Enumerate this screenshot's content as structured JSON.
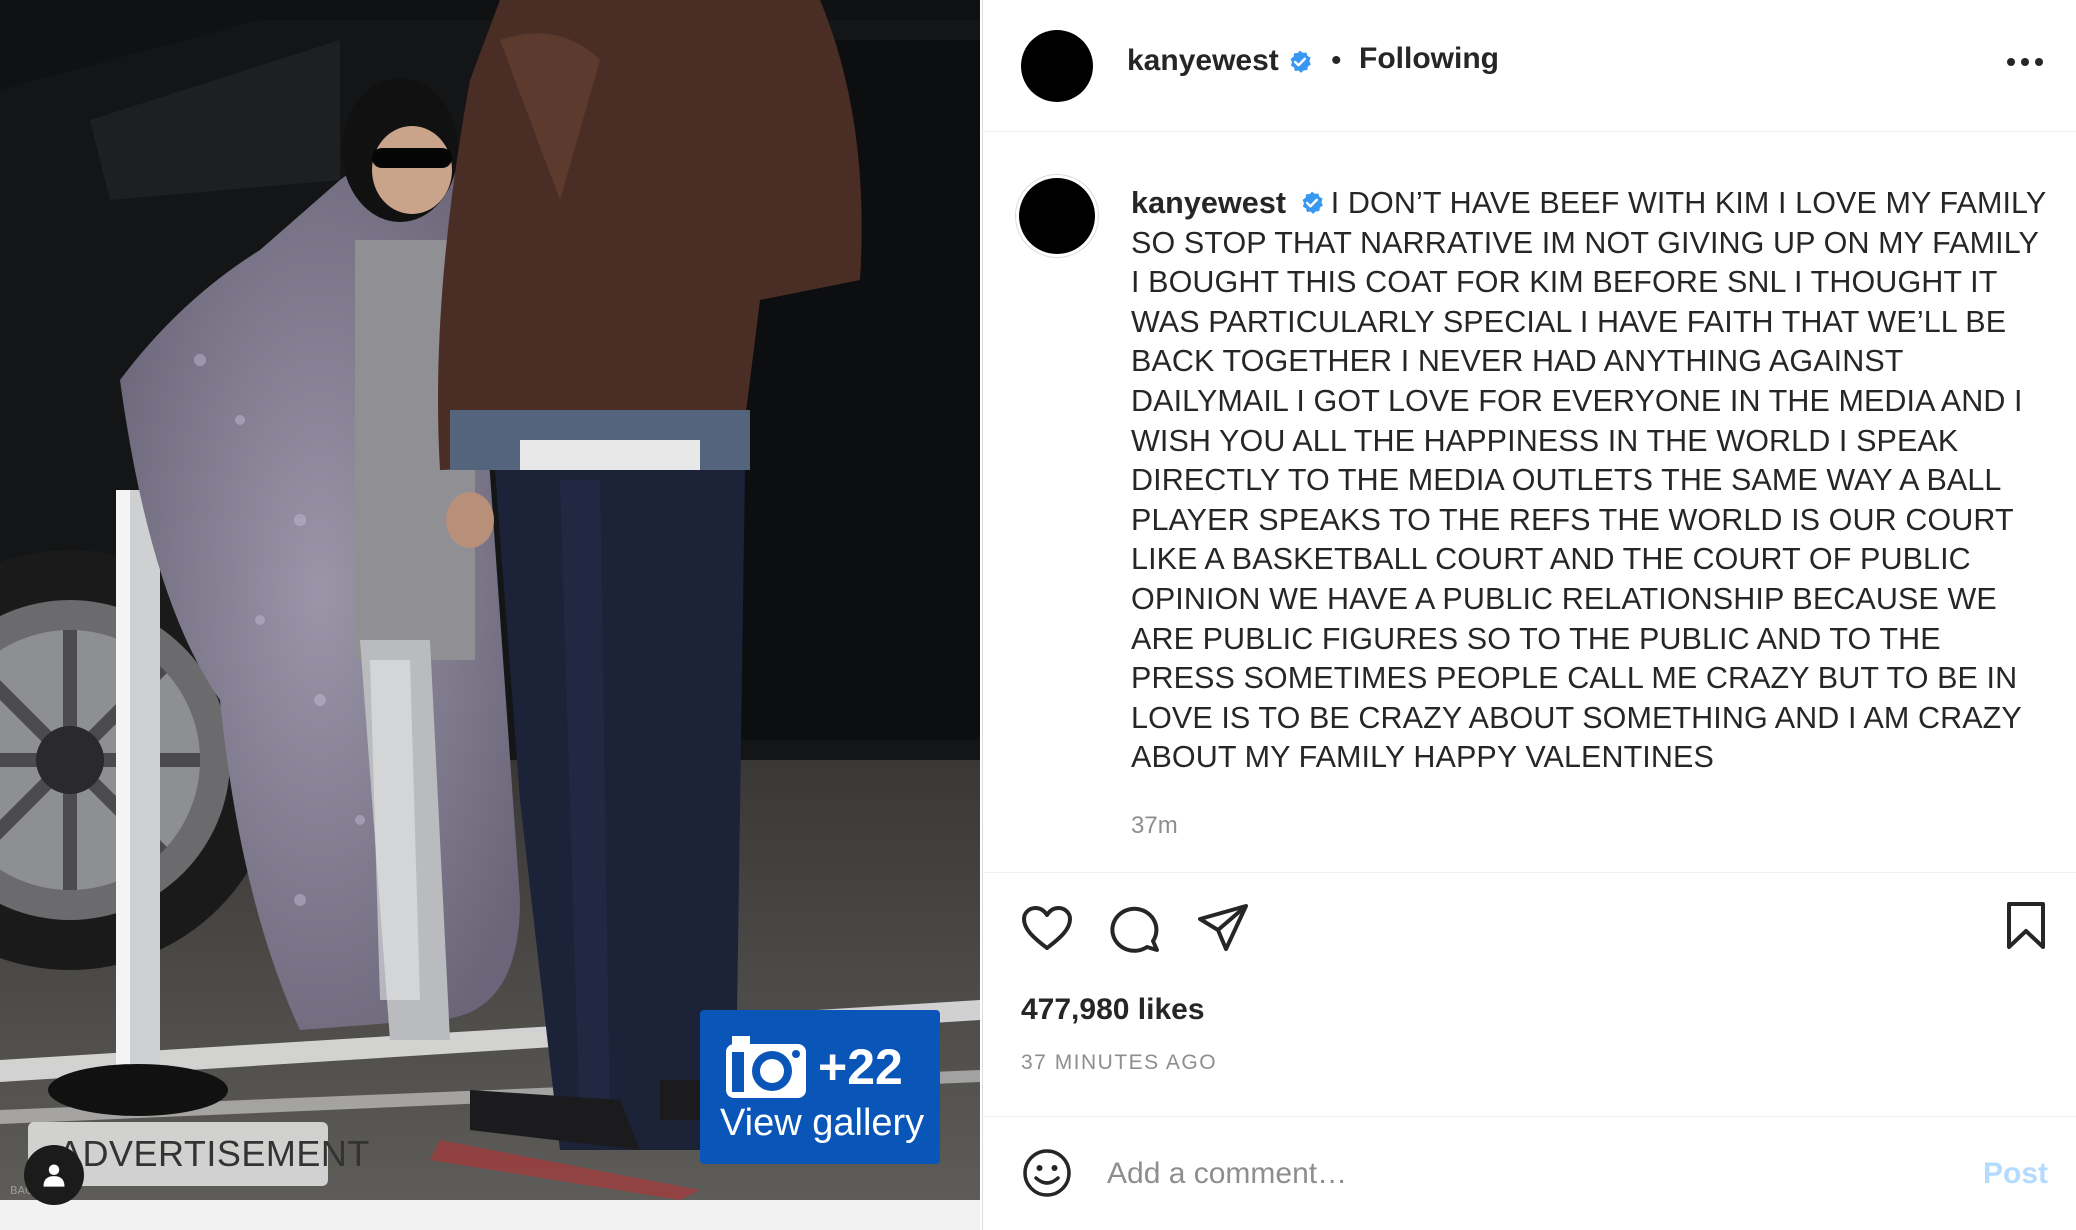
{
  "media": {
    "advertisement_label": "ADVERTISEMENT",
    "photo_credit": "BACKGRID",
    "gallery": {
      "count": "+22",
      "label": "View gallery"
    }
  },
  "header": {
    "username": "kanyewest",
    "separator": "•",
    "follow_status": "Following"
  },
  "post": {
    "username": "kanyewest",
    "caption": "I DON’T HAVE BEEF WITH KIM I LOVE MY FAMILY SO STOP THAT NARRATIVE IM NOT GIVING UP ON MY FAMILY I BOUGHT THIS COAT FOR KIM BEFORE SNL I THOUGHT IT WAS PARTICULARLY SPECIAL I HAVE FAITH THAT WE’LL BE BACK TOGETHER I NEVER HAD ANYTHING AGAINST DAILYMAIL I GOT LOVE FOR EVERYONE IN THE MEDIA AND I WISH YOU ALL THE HAPPINESS IN THE WORLD I SPEAK DIRECTLY TO THE MEDIA OUTLETS THE SAME WAY A BALL PLAYER SPEAKS TO THE REFS THE WORLD IS OUR COURT LIKE A BASKETBALL COURT AND THE COURT OF PUBLIC OPINION WE HAVE A PUBLIC RELATIONSHIP BECAUSE WE ARE PUBLIC FIGURES SO TO THE PUBLIC AND TO THE PRESS SOMETIMES PEOPLE CALL ME CRAZY BUT TO BE IN LOVE IS TO BE CRAZY ABOUT SOMETHING AND I AM CRAZY ABOUT MY FAMILY HAPPY VALENTINES",
    "time_short": "37m",
    "likes": "477,980 likes",
    "time_long": "37 MINUTES AGO"
  },
  "actions": {
    "icons": [
      "heart-icon",
      "comment-icon",
      "share-icon",
      "bookmark-icon"
    ]
  },
  "comment": {
    "placeholder": "Add a comment…",
    "post_label": "Post"
  },
  "colors": {
    "verified_blue": "#3897f0",
    "gallery_blue": "#0a56b8",
    "post_disabled": "#b3dbff",
    "muted_text": "#8e8e8e"
  }
}
